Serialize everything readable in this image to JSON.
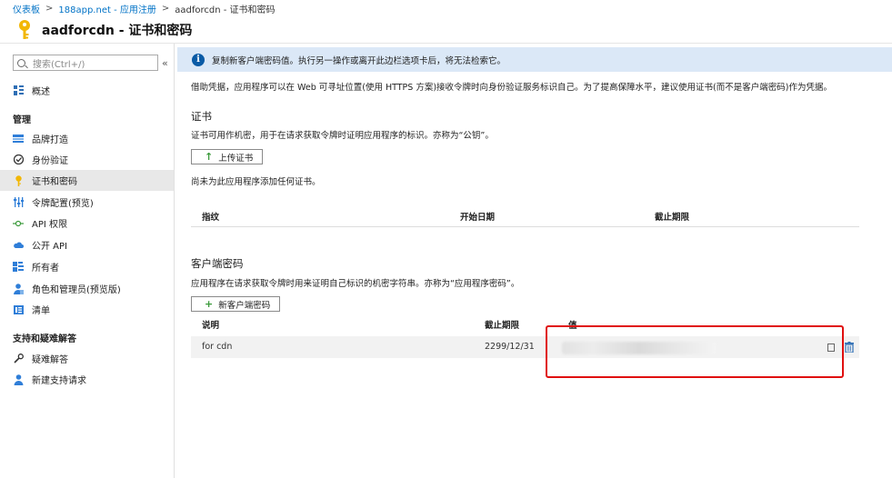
{
  "breadcrumb": {
    "items": [
      "仪表板",
      "188app.net - 应用注册",
      "aadforcdn - 证书和密码"
    ],
    "separator": ">"
  },
  "title": "aadforcdn - 证书和密码",
  "sidebar": {
    "search_placeholder": "搜索(Ctrl+/)",
    "collapse": "«",
    "overview": {
      "label": "概述",
      "icon": "overview-icon"
    },
    "manage_heading": "管理",
    "items": [
      {
        "label": "品牌打造",
        "icon": "branding-icon"
      },
      {
        "label": "身份验证",
        "icon": "authentication-icon"
      },
      {
        "label": "证书和密码",
        "icon": "key-icon",
        "active": true
      },
      {
        "label": "令牌配置(预览)",
        "icon": "token-config-icon"
      },
      {
        "label": "API 权限",
        "icon": "api-permissions-icon"
      },
      {
        "label": "公开 API",
        "icon": "cloud-icon"
      },
      {
        "label": "所有者",
        "icon": "owners-icon"
      },
      {
        "label": "角色和管理员(预览版)",
        "icon": "roles-icon"
      },
      {
        "label": "清单",
        "icon": "manifest-icon"
      }
    ],
    "support_heading": "支持和疑难解答",
    "support_items": [
      {
        "label": "疑难解答",
        "icon": "wrench-icon"
      },
      {
        "label": "新建支持请求",
        "icon": "support-user-icon"
      }
    ]
  },
  "main": {
    "info_banner": "复制新客户端密码值。执行另一操作或离开此边栏选项卡后，将无法检索它。",
    "intro": "借助凭据，应用程序可以在 Web 可寻址位置(使用 HTTPS 方案)接收令牌时向身份验证服务标识自己。为了提高保障水平，建议使用证书(而不是客户端密码)作为凭据。",
    "certificates": {
      "title": "证书",
      "description": "证书可用作机密，用于在请求获取令牌时证明应用程序的标识。亦称为“公钥”。",
      "upload_button": "上传证书",
      "empty_text": "尚未为此应用程序添加任何证书。",
      "columns": [
        "指纹",
        "开始日期",
        "截止期限"
      ]
    },
    "client_secrets": {
      "title": "客户端密码",
      "description": "应用程序在请求获取令牌时用来证明自己标识的机密字符串。亦称为“应用程序密码”。",
      "new_button": "新客户端密码",
      "columns": [
        "说明",
        "截止期限",
        "值"
      ],
      "rows": [
        {
          "description": "for cdn",
          "expires": "2299/12/31",
          "value_masked": true
        }
      ]
    }
  },
  "colors": {
    "accent": "#0072c6",
    "info_bg": "#dbe8f7",
    "highlight_border": "#e01010",
    "key": "#f2b705"
  }
}
